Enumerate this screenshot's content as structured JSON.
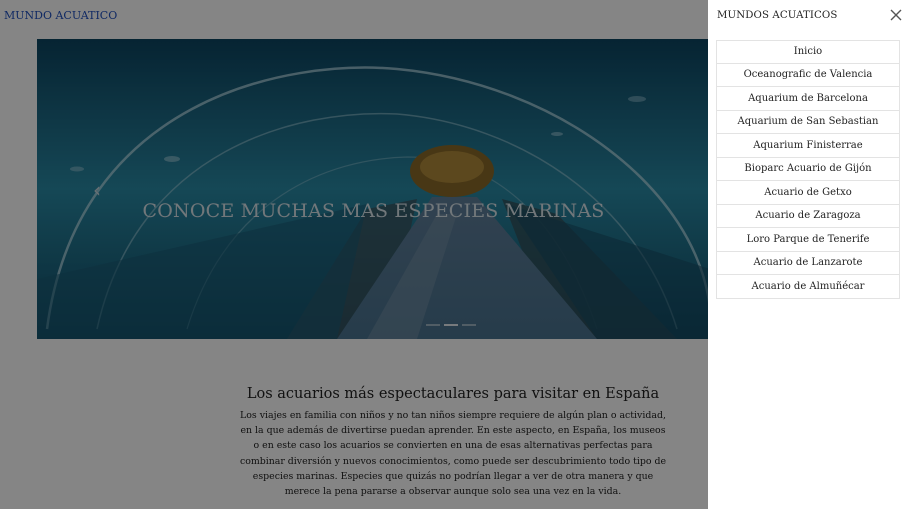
{
  "header": {
    "brand": "MUNDO ACUATICO"
  },
  "carousel": {
    "caption": "CONOCE MUCHAS MAS ESPECIES MARINAS",
    "prev_icon": "‹",
    "indicator_count": 3,
    "active_indicator": 1
  },
  "article": {
    "title": "Los acuarios más espectaculares para visitar en España",
    "body": "Los viajes en familia con niños y no tan niños siempre requiere de algún plan o actividad, en la que además de divertirse puedan aprender. En este aspecto, en España, los museos o en este caso los acuarios se convierten en una de esas alternativas perfectas para combinar diversión y nuevos conocimientos, como puede ser descubrimiento todo tipo de especies marinas. Especies que quizás no podrían llegar a ver de otra manera y que merece la pena pararse a observar aunque solo sea una vez en la vida."
  },
  "offcanvas": {
    "title": "MUNDOS ACUATICOS",
    "close_icon": "close-icon",
    "items": [
      {
        "label": "Inicio"
      },
      {
        "label": "Oceanografic de Valencia"
      },
      {
        "label": "Aquarium de Barcelona"
      },
      {
        "label": "Aquarium de San Sebastian"
      },
      {
        "label": "Aquarium Finisterrae"
      },
      {
        "label": "Bioparc Acuario de Gijón"
      },
      {
        "label": "Acuario de Getxo"
      },
      {
        "label": "Acuario de Zaragoza"
      },
      {
        "label": "Loro Parque de Tenerife"
      },
      {
        "label": "Acuario de Lanzarote"
      },
      {
        "label": "Acuario de Almuñécar"
      }
    ]
  },
  "colors": {
    "brand_link": "#1f4fbf",
    "overlay": "rgba(0,0,0,0.48)"
  }
}
